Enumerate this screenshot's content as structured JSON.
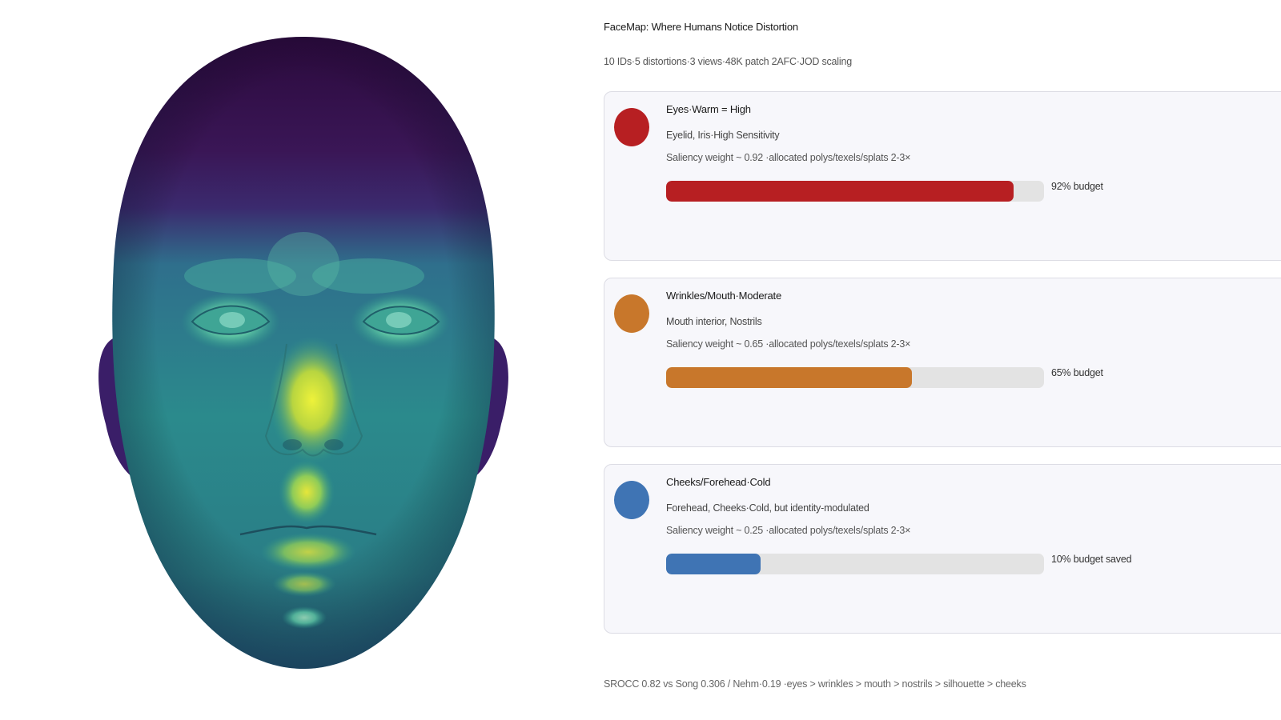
{
  "header": {
    "title": "FaceMap: Where Humans Notice Distortion",
    "subtitle": "10 IDs·5 distortions·3 views·48K patch 2AFC·JOD scaling"
  },
  "cards": [
    {
      "title": "Eyes·Warm = High",
      "regions": "Eyelid, Iris·High Sensitivity",
      "weight": "Saliency weight ~ 0.92 ·allocated polys/texels/splats 2-3×",
      "budget_fraction": 0.92,
      "budget_label": "92% budget",
      "color": "#b71f22"
    },
    {
      "title": "Wrinkles/Mouth·Moderate",
      "regions": "Mouth interior, Nostrils",
      "weight": "Saliency weight ~ 0.65 ·allocated polys/texels/splats 2-3×",
      "budget_fraction": 0.65,
      "budget_label": "65% budget",
      "color": "#c8772b"
    },
    {
      "title": "Cheeks/Forehead·Cold",
      "regions": "Forehead, Cheeks·Cold, but identity-modulated",
      "weight": "Saliency weight ~ 0.25 ·allocated polys/texels/splats 2-3×",
      "budget_fraction": 0.25,
      "budget_label": "10% budget saved",
      "color": "#3f74b4"
    }
  ],
  "footer": {
    "text": "SROCC 0.82 vs Song 0.306 / Nehm·0.19 ·eyes > wrinkles > mouth > nostrils > silhouette > cheeks"
  },
  "image": {
    "icon": "face-heatmap-render",
    "colormap": [
      "#2b0a3d",
      "#3b2a6e",
      "#2f6f8c",
      "#29a08a",
      "#7fc65a",
      "#dde43a"
    ]
  }
}
